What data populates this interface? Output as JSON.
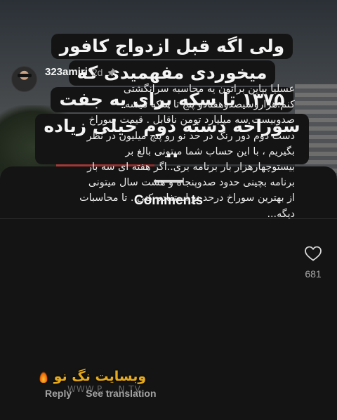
{
  "video": {
    "caption_lines": [
      "ولی  اگه قبل ازدواج کافور",
      "میخوردی مفهمیدی که",
      "۱۳۷۵ تا سکه برای یه جفت",
      "سوراخه دسته دوم خیلی زیاده .."
    ],
    "caption_emoji": "laughing-face-icon"
  },
  "sheet": {
    "title": "Comments"
  },
  "comment": {
    "username": "323amiri",
    "time": "2d",
    "pin_icon": "pin-icon",
    "body_lines": [
      "عسلیا بیاین براتون یه محاسبه سرانگشتی",
      "کنم.هزاروسیصدوهفتادو پنج تا سکه میشه",
      "صدوبیست سه میلیارد تومن ناقابل . قیمت سوراخ",
      "دست دوم دور رنگ در حد نو رو پنج میلیون در نظر",
      "بگیریم ، با این حساب شما میتونی بالغ بر",
      "بیستوچهارهزار بار برنامه بری..اگر هفته ای سه بار",
      "برنامه بچینی حدود صدوپنجاه و هشت سال میتونی",
      "از بهترین سوراخ درحد نو استفاده کنی . تا محاسبات",
      "دیگه..."
    ],
    "like_icon": "heart-icon",
    "like_count": "681",
    "reply_label": "Reply",
    "translation_label": "See translation"
  },
  "watermark": {
    "text": "وبسایت نگ نو",
    "url": "WWW.P.....N.TV"
  },
  "colors": {
    "sheet_bg": "#141414",
    "watermark": "#f2b31d"
  }
}
